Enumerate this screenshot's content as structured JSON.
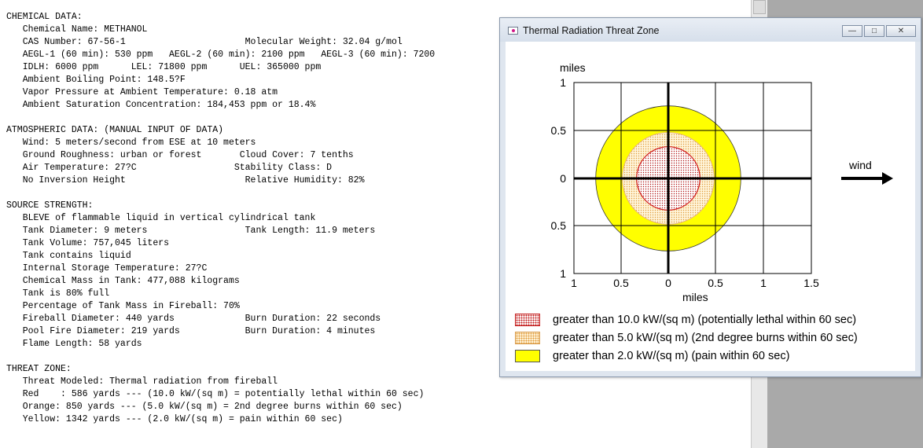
{
  "report": {
    "lines": [
      "CHEMICAL DATA:",
      "   Chemical Name: METHANOL",
      "   CAS Number: 67-56-1                      Molecular Weight: 32.04 g/mol",
      "   AEGL-1 (60 min): 530 ppm   AEGL-2 (60 min): 2100 ppm   AEGL-3 (60 min): 7200",
      "   IDLH: 6000 ppm      LEL: 71800 ppm      UEL: 365000 ppm",
      "   Ambient Boiling Point: 148.5?F",
      "   Vapor Pressure at Ambient Temperature: 0.18 atm",
      "   Ambient Saturation Concentration: 184,453 ppm or 18.4%",
      "",
      "ATMOSPHERIC DATA: (MANUAL INPUT OF DATA)",
      "   Wind: 5 meters/second from ESE at 10 meters",
      "   Ground Roughness: urban or forest       Cloud Cover: 7 tenths",
      "   Air Temperature: 27?C                  Stability Class: D",
      "   No Inversion Height                      Relative Humidity: 82%",
      "",
      "SOURCE STRENGTH:",
      "   BLEVE of flammable liquid in vertical cylindrical tank",
      "   Tank Diameter: 9 meters                  Tank Length: 11.9 meters",
      "   Tank Volume: 757,045 liters",
      "   Tank contains liquid",
      "   Internal Storage Temperature: 27?C",
      "   Chemical Mass in Tank: 477,088 kilograms",
      "   Tank is 80% full",
      "   Percentage of Tank Mass in Fireball: 70%",
      "   Fireball Diameter: 440 yards             Burn Duration: 22 seconds",
      "   Pool Fire Diameter: 219 yards            Burn Duration: 4 minutes",
      "   Flame Length: 58 yards",
      "",
      "THREAT ZONE:",
      "   Threat Modeled: Thermal radiation from fireball",
      "   Red    : 586 yards --- (10.0 kW/(sq m) = potentially lethal within 60 sec)",
      "   Orange: 850 yards --- (5.0 kW/(sq m) = 2nd degree burns within 60 sec)",
      "   Yellow: 1342 yards --- (2.0 kW/(sq m) = pain within 60 sec)"
    ]
  },
  "window": {
    "title": "Thermal Radiation Threat Zone",
    "btn_min": "―",
    "btn_max": "□",
    "btn_close": "✕"
  },
  "plot": {
    "y_unit_label": "miles",
    "x_unit_label": "miles",
    "y_ticks": [
      "1",
      "0.5",
      "0",
      "0.5",
      "1"
    ],
    "x_ticks": [
      "1",
      "0.5",
      "0",
      "0.5",
      "1",
      "1.5"
    ],
    "wind_label": "wind",
    "zones_miles": {
      "yellow": 0.763,
      "orange": 0.483,
      "red": 0.333
    },
    "colors": {
      "yellow": "#ffff00",
      "orange_dot": "#e09a3a",
      "red_line": "#d01818",
      "red_dot": "#b01010"
    }
  },
  "legend": {
    "red": "greater than 10.0 kW/(sq m) (potentially lethal within 60 sec)",
    "orange": "greater than 5.0 kW/(sq m) (2nd degree burns within 60 sec)",
    "yellow": "greater than 2.0 kW/(sq m) (pain within 60 sec)"
  }
}
